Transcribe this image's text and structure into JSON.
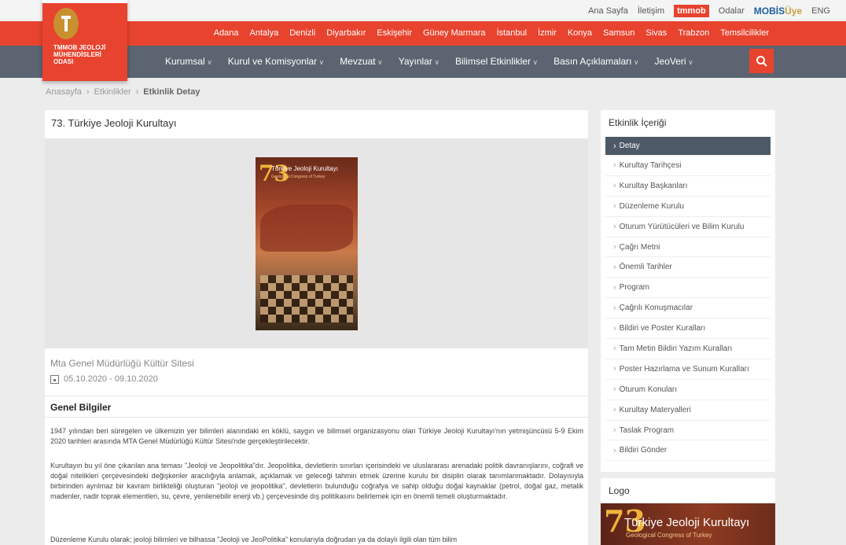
{
  "topbar": {
    "links": [
      "Ana Sayfa",
      "İletişim"
    ],
    "tmmob": "tmmob",
    "odalar": "Odalar",
    "mobis_a": "MOBİS",
    "mobis_b": "Üye",
    "lang": "ENG"
  },
  "logo": {
    "text": "TMMOB JEOLOJİ MÜHENDİSLERİ ODASI"
  },
  "cities": [
    "Adana",
    "Antalya",
    "Denizli",
    "Diyarbakır",
    "Eskişehir",
    "Güney Marmara",
    "İstanbul",
    "İzmir",
    "Konya",
    "Samsun",
    "Sivas",
    "Trabzon",
    "Temsilcilikler"
  ],
  "nav": [
    "Kurumsal",
    "Kurul ve Komisyonlar",
    "Mevzuat",
    "Yayınlar",
    "Bilimsel Etkinlikler",
    "Basın Açıklamaları",
    "JeoVeri"
  ],
  "breadcrumb": {
    "home": "Anasayfa",
    "events": "Etkinlikler",
    "current": "Etkinlik Detay",
    "sep": "›"
  },
  "main": {
    "title": "73. Türkiye Jeoloji Kurultayı",
    "poster": {
      "num": "73",
      "title": "Türkiye Jeoloji Kurultayı",
      "sub": "Geological Congress of Turkey"
    },
    "venue": "Mta Genel Müdürlüğü Kültür Sitesi",
    "dates": "05.10.2020 - 09.10.2020",
    "section": "Genel Bilgiler",
    "p1": "1947 yılından beri süregelen ve ülkemizin yer bilimleri alanındaki en köklü, saygın ve bilimsel organizasyonu olan Türkiye Jeoloji Kurultayı'nın yetmişüncüsü 5-9 Ekim 2020 tarihleri arasında MTA Genel Müdürlüğü Kültür Sitesi'nde gerçekleştirilecektir.",
    "p2": "Kurultayın bu yıl öne çıkarılan ana teması \"Jeoloji ve Jeopolitika\"dır. Jeopolitika, devletlerin sınırları içerisindeki ve uluslararası arenadaki politik davranışlarını, coğrafi ve doğal nitelikleri çerçevesindeki değişkenler aracılığıyla anlamak, açıklamak ve geleceği tahmin etmek üzerine kurulu bir disiplin olarak tanımlanmaktadır. Dolayısıyla birbirinden ayrılmaz bir kavram birlikteliği oluşturan \"jeoloji ve jeopolitika\", devletlerin bulunduğu coğrafya ve sahip olduğu doğal kaynaklar (petrol, doğal gaz, metalik madenler, nadir toprak elementleri, su, çevre, yenilenebilir enerji vb.) çerçevesinde dış politikasını belirlemek için en önemli temeli oluşturmaktadır.",
    "p3": "Düzenleme Kurulu olarak; jeoloji bilimleri ve bilhassa \"Jeoloji ve JeoPolitika\" konularıyla doğrudan ya da dolaylı ilgili olan tüm bilim"
  },
  "sidebar": {
    "heading": "Etkinlik İçeriği",
    "items": [
      "Detay",
      "Kurultay Tarihçesi",
      "Kurultay Başkanları",
      "Düzenleme Kurulu",
      "Oturum Yürütücüleri ve Bilim Kurulu",
      "Çağrı Metni",
      "Önemli Tarihler",
      "Program",
      "Çağrılı Konuşmacılar",
      "Bildiri ve Poster Kuralları",
      "Tam Metin Bildiri Yazım Kuralları",
      "Poster Hazırlama ve Sunum Kuralları",
      "Oturum Konuları",
      "Kurultay Materyalleri",
      "Taslak Program",
      "Bildiri Gönder"
    ]
  },
  "logo_box": {
    "heading": "Logo",
    "num": "73",
    "title": "Türkiye Jeoloji Kurultayı",
    "sub": "Geological Congress of Turkey"
  },
  "colors": {
    "brand_red": "#e8432e",
    "nav_gray": "#5b6470",
    "active_item": "#4d5966"
  }
}
